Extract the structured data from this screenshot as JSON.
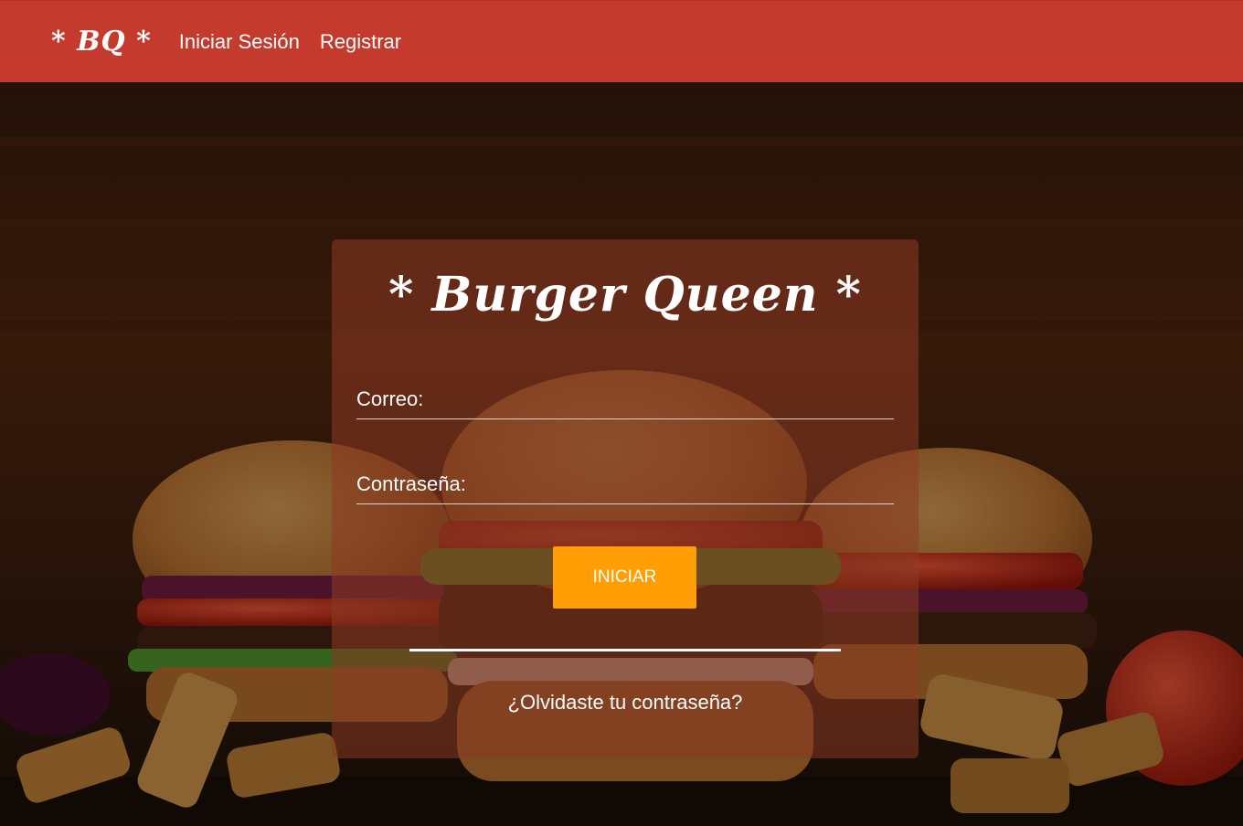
{
  "navbar": {
    "brand": "* BQ *",
    "links": [
      "Iniciar Sesión",
      "Registrar"
    ]
  },
  "login": {
    "title": "* Burger Queen *",
    "email_label": "Correo:",
    "email_value": "",
    "password_label": "Contraseña:",
    "password_value": "",
    "submit_label": "INICIAR",
    "forgot_link": "¿Olvidaste tu contraseña?"
  },
  "colors": {
    "navbar_bg": "#c43b2d",
    "button_bg": "#ff9f05",
    "card_overlay": "rgba(140,58,35,0.55)",
    "text": "#ffffff"
  },
  "background": {
    "image": "burgers-and-fries-icon"
  }
}
